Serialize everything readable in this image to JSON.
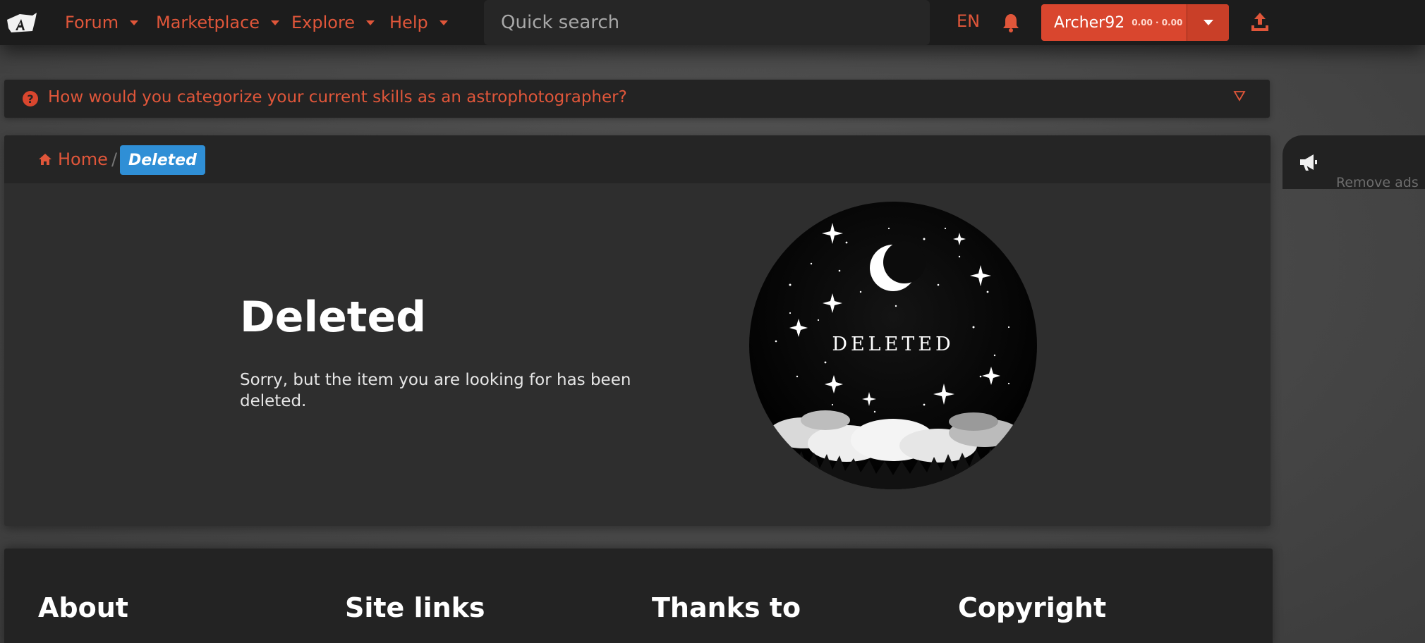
{
  "header": {
    "logo_icon": "astrobin-logo-icon",
    "nav": [
      {
        "label": "Forum"
      },
      {
        "label": "Marketplace"
      },
      {
        "label": "Explore"
      },
      {
        "label": "Help"
      }
    ],
    "search": {
      "placeholder": "Quick search"
    },
    "language": "EN",
    "notifications_icon": "bell-icon",
    "user": {
      "name": "Archer92",
      "stats": "0.00 · 0.00"
    },
    "upload_icon": "upload-icon"
  },
  "poll": {
    "icon": "question-circle-icon",
    "question": "How would you categorize your current skills as an astrophotographer?",
    "toggle_icon": "triangle-down-icon"
  },
  "breadcrumb": {
    "home_label": "Home",
    "separator": "/",
    "current": "Deleted"
  },
  "main": {
    "title": "Deleted",
    "message": "Sorry, but the item you are looking for has been deleted.",
    "image_caption": "DELETED"
  },
  "footer": {
    "headings": [
      "About",
      "Site links",
      "Thanks to",
      "Copyright"
    ]
  },
  "ads": {
    "icon": "megaphone-icon",
    "label": "Remove ads"
  },
  "colors": {
    "accent": "#e0563a",
    "button": "#d9462e",
    "badge": "#2f8fd6",
    "topbar": "#1c1c1c",
    "panel": "#2e2e2e"
  }
}
